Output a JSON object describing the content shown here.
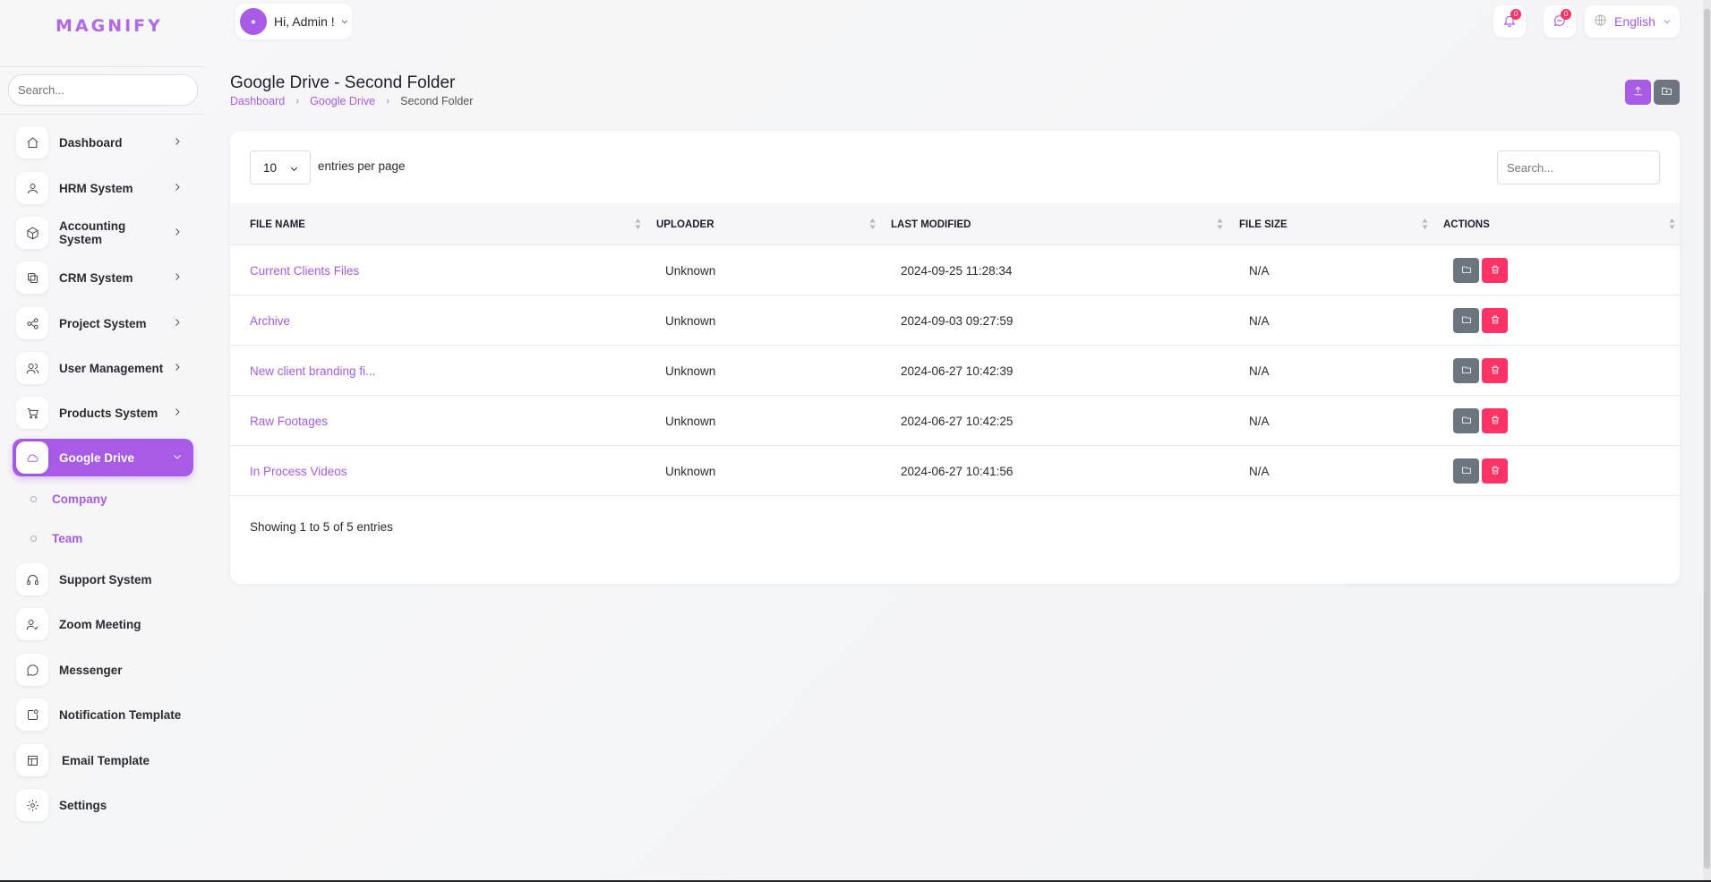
{
  "brand": {
    "logo_text": "MAGNIFY",
    "accent": "#a85be6"
  },
  "sidebar": {
    "search_placeholder": "Search...",
    "items": [
      {
        "label": "Dashboard",
        "icon": "home-icon",
        "has_children": true
      },
      {
        "label": "HRM System",
        "icon": "user-icon",
        "has_children": true
      },
      {
        "label": "Accounting System",
        "icon": "box-icon",
        "has_children": true
      },
      {
        "label": "CRM System",
        "icon": "layers-icon",
        "has_children": true
      },
      {
        "label": "Project System",
        "icon": "share-icon",
        "has_children": true
      },
      {
        "label": "User Management",
        "icon": "users-icon",
        "has_children": true
      },
      {
        "label": "Products System",
        "icon": "cart-icon",
        "has_children": true
      },
      {
        "label": "Google Drive",
        "icon": "cloud-icon",
        "has_children": true,
        "active": true
      },
      {
        "label": "Support System",
        "icon": "headphones-icon",
        "has_children": false
      },
      {
        "label": "Zoom Meeting",
        "icon": "user-check-icon",
        "has_children": false
      },
      {
        "label": "Messenger",
        "icon": "message-icon",
        "has_children": false
      },
      {
        "label": "Notification Template",
        "icon": "notification-icon",
        "has_children": false
      },
      {
        "label": "Email Template",
        "icon": "template-icon",
        "has_children": false
      },
      {
        "label": "Settings",
        "icon": "gear-icon",
        "has_children": false
      }
    ],
    "sub_items": [
      {
        "label": "Company"
      },
      {
        "label": "Team"
      }
    ]
  },
  "header": {
    "greeting": "Hi, Admin !",
    "notifications_count": "0",
    "messages_count": "0",
    "language": "English"
  },
  "page": {
    "title": "Google Drive - Second Folder",
    "breadcrumb": [
      "Dashboard",
      "Google Drive",
      "Second Folder"
    ]
  },
  "table": {
    "per_page_value": "10",
    "per_page_label": "entries per page",
    "search_placeholder": "Search...",
    "columns": [
      "FILE NAME",
      "UPLOADER",
      "LAST MODIFIED",
      "FILE SIZE",
      "ACTIONS"
    ],
    "rows": [
      {
        "name": "Current Clients Files",
        "uploader": "Unknown",
        "modified": "2024-09-25 11:28:34",
        "size": "N/A"
      },
      {
        "name": "Archive",
        "uploader": "Unknown",
        "modified": "2024-09-03 09:27:59",
        "size": "N/A"
      },
      {
        "name": "New client branding fi...",
        "uploader": "Unknown",
        "modified": "2024-06-27 10:42:39",
        "size": "N/A"
      },
      {
        "name": "Raw Footages",
        "uploader": "Unknown",
        "modified": "2024-06-27 10:42:25",
        "size": "N/A"
      },
      {
        "name": "In Process Videos",
        "uploader": "Unknown",
        "modified": "2024-06-27 10:41:56",
        "size": "N/A"
      }
    ],
    "footer": "Showing 1 to 5 of 5 entries"
  }
}
